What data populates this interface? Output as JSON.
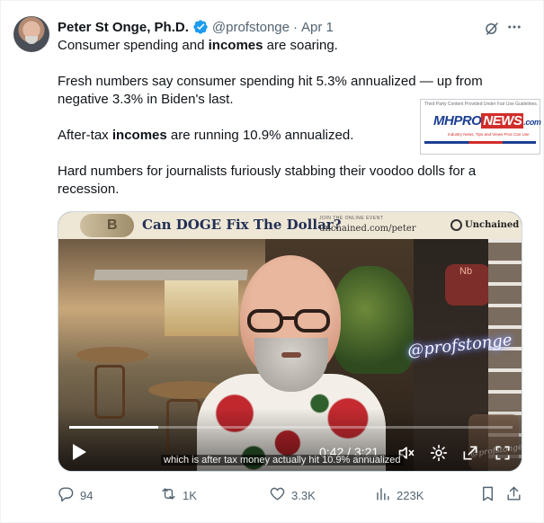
{
  "author": {
    "name": "Peter St Onge, Ph.D.",
    "handle": "@profstonge",
    "separator": "·",
    "date": "Apr 1"
  },
  "post": {
    "line1_pre": "Consumer spending and ",
    "line1_bold": "incomes",
    "line1_post": " are soaring.",
    "para2": "Fresh numbers say consumer spending hit 5.3% annualized — up from negative 3.3% in Biden's last.",
    "line3_pre": "After-tax ",
    "line3_bold": "incomes",
    "line3_post": " are running 10.9% annualized.",
    "para4": "Hard numbers for journalists furiously stabbing their voodoo dolls for a recession."
  },
  "watermark": {
    "top_text": "Third Party Content Provided Under Fair Use Guidelines.",
    "logo_mh": "MH",
    "logo_pro": "PRO",
    "logo_news": "NEWS",
    "logo_com": ".com",
    "tagline": "Industry News, Tips and Views Pros Can Use"
  },
  "video": {
    "banner_badge": "B",
    "banner_title": "Can DOGE Fix The Dollar?",
    "banner_join": "JOIN THE ONLINE EVENT",
    "banner_url": "unchained.com/peter",
    "banner_logo": "Unchained",
    "sign_text": "Nb",
    "neon_text": "@profstonge",
    "caption": "which is after tax money actually hit 10.9% annualized",
    "time": "0:42 / 3:21",
    "progress_fraction": 0.2,
    "corner_watermark": "@profstonge Apr 1, 2025"
  },
  "actions": {
    "replies": "94",
    "reposts": "1K",
    "likes": "3.3K",
    "views": "223K"
  },
  "icons": {
    "verified": "verified-badge-icon",
    "grok": "grok-icon",
    "more": "more-icon",
    "reply": "reply-icon",
    "repost": "repost-icon",
    "like": "like-icon",
    "views": "views-icon",
    "bookmark": "bookmark-icon",
    "share": "share-icon"
  },
  "colors": {
    "verified_blue": "#1d9bf0",
    "secondary_text": "#536471",
    "primary_text": "#0f1419"
  }
}
